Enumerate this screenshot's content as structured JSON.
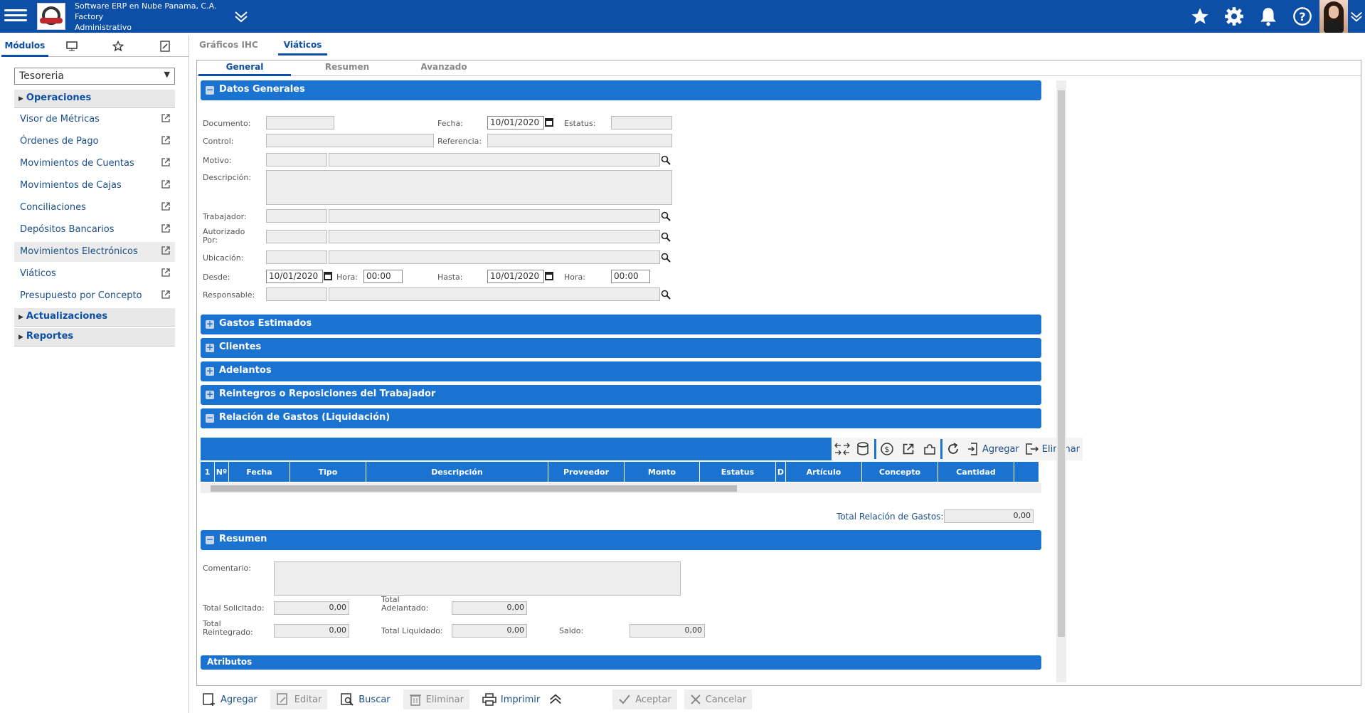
{
  "header": {
    "company_line1": "Software ERP en Nube Panama, C.A.",
    "company_line2": "Factory",
    "company_line3": "Administrativo",
    "icons": [
      "menu-icon",
      "chevron-double-down-icon",
      "star-icon",
      "gear-icon",
      "bell-icon",
      "help-icon",
      "avatar"
    ]
  },
  "sidebar": {
    "tab_label": "Módulos",
    "module_selected": "Tesoreria",
    "groups": {
      "operaciones": "Operaciones",
      "actualizaciones": "Actualizaciones",
      "reportes": "Reportes"
    },
    "items": [
      "Visor de Métricas",
      "Órdenes de Pago",
      "Movimientos de Cuentas",
      "Movimientos de Cajas",
      "Conciliaciones",
      "Depósitos Bancarios",
      "Movimientos Electrónicos",
      "Viáticos",
      "Presupuesto por Concepto"
    ]
  },
  "main_tabs": [
    "Gráficos IHC",
    "Viáticos"
  ],
  "sub_tabs": [
    "General",
    "Resumen",
    "Avanzado"
  ],
  "sections": {
    "datos_generales": "Datos Generales",
    "gastos_estimados": "Gastos Estimados",
    "clientes": "Clientes",
    "adelantos": "Adelantos",
    "reintegros": "Reintegros o Reposiciones del Trabajador",
    "relacion": "Relación de Gastos (Liquidación)",
    "resumen": "Resumen",
    "atributos": "Atributos"
  },
  "form": {
    "documento_label": "Documento:",
    "fecha_label": "Fecha:",
    "fecha_value": "10/01/2020",
    "estatus_label": "Estatus:",
    "control_label": "Control:",
    "referencia_label": "Referencia:",
    "motivo_label": "Motivo:",
    "descripcion_label": "Descripción:",
    "trabajador_label": "Trabajador:",
    "autorizado_label1": "Autorizado",
    "autorizado_label2": "Por:",
    "ubicacion_label": "Ubicación:",
    "desde_label": "Desde:",
    "desde_value": "10/01/2020",
    "hora_label": "Hora:",
    "hora_desde_value": "00:00",
    "hasta_label": "Hasta:",
    "hasta_value": "10/01/2020",
    "hora_hasta_value": "00:00",
    "responsable_label": "Responsable:"
  },
  "grid": {
    "buttons": {
      "agregar": "Agregar",
      "eliminar": "Eliminar"
    },
    "columns": [
      "1",
      "Nº",
      "Fecha",
      "Tipo",
      "Descripción",
      "Proveedor",
      "Monto",
      "Estatus",
      "D",
      "Artículo",
      "Concepto",
      "Cantidad"
    ],
    "total_label": "Total Relación de Gastos:",
    "total_value": "0,00"
  },
  "resumen": {
    "comentario_label": "Comentario:",
    "total_solicitado_label": "Total Solicitado:",
    "total_solicitado_value": "0,00",
    "total_adelantado_label1": "Total",
    "total_adelantado_label2": "Adelantado:",
    "total_adelantado_value": "0,00",
    "total_reintegrado_label1": "Total",
    "total_reintegrado_label2": "Reintegrado:",
    "total_reintegrado_value": "0,00",
    "total_liquidado_label": "Total Liquidado:",
    "total_liquidado_value": "0,00",
    "saldo_label": "Saldo:",
    "saldo_value": "0,00"
  },
  "bottom_bar": {
    "agregar": "Agregar",
    "editar": "Editar",
    "buscar": "Buscar",
    "eliminar": "Eliminar",
    "imprimir": "Imprimir",
    "aceptar": "Aceptar",
    "cancelar": "Cancelar"
  },
  "colors": {
    "header": "#0d4ea6",
    "section": "#1a73d1",
    "link": "#1c4f8a"
  }
}
